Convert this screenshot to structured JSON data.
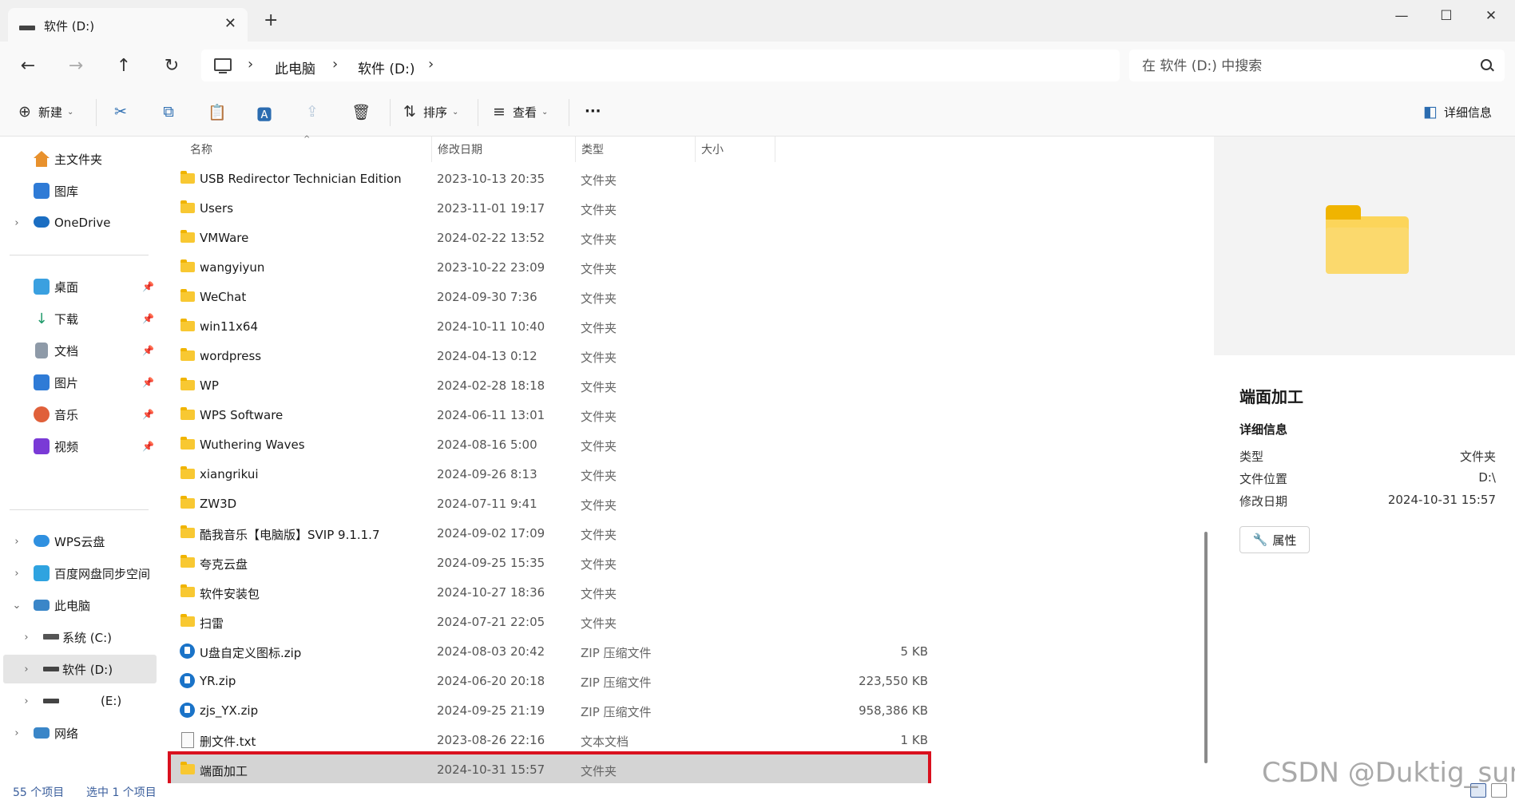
{
  "window": {
    "tab_title": "软件 (D:)",
    "tab_close": "✕",
    "new_tab": "+",
    "controls": {
      "minimize": "—",
      "maximize": "☐",
      "close": "✕"
    }
  },
  "nav": {
    "back": "←",
    "forward": "→",
    "up": "↑",
    "refresh": "↻",
    "breadcrumb": [
      "此电脑",
      "软件 (D:)"
    ],
    "separator": "›"
  },
  "search": {
    "placeholder": "在 软件 (D:) 中搜索"
  },
  "toolbar": {
    "new": "新建",
    "sort": "排序",
    "view": "查看",
    "more": "···",
    "details": "详细信息",
    "icons": {
      "new": "⊕",
      "cut": "✂",
      "copy": "⧉",
      "paste": "📋",
      "rename": "🅰",
      "share": "⇪",
      "delete": "🗑",
      "sort": "⇅",
      "view": "≡",
      "details": "◧"
    }
  },
  "sidebar": {
    "quick": [
      {
        "label": "主文件夹",
        "icon": "home-icon",
        "color": "#e8912d"
      },
      {
        "label": "图库",
        "icon": "gallery-icon",
        "color": "#2f7bd6"
      },
      {
        "label": "OneDrive",
        "icon": "onedrive-icon",
        "color": "#1b6ec2"
      }
    ],
    "pinned": [
      {
        "label": "桌面",
        "icon": "desktop-icon",
        "color": "#3aa0e0"
      },
      {
        "label": "下载",
        "icon": "download-icon",
        "color": "#1f9a6a"
      },
      {
        "label": "文档",
        "icon": "documents-icon",
        "color": "#8e9aa8"
      },
      {
        "label": "图片",
        "icon": "pictures-icon",
        "color": "#2f7bd6"
      },
      {
        "label": "音乐",
        "icon": "music-icon",
        "color": "#e0603a"
      },
      {
        "label": "视频",
        "icon": "videos-icon",
        "color": "#7a3ad6"
      }
    ],
    "places": [
      {
        "label": "WPS云盘",
        "icon": "wps-cloud-icon",
        "color": "#2f90e0"
      },
      {
        "label": "百度网盘同步空间",
        "icon": "baidu-netdisk-icon",
        "color": "#2fa3e0"
      },
      {
        "label": "此电脑",
        "icon": "this-pc-icon",
        "color": "#3a86c8"
      },
      {
        "label": "系统 (C:)",
        "icon": "drive-c-icon",
        "color": "#555555"
      },
      {
        "label": "软件 (D:)",
        "icon": "drive-d-icon",
        "color": "#444444"
      },
      {
        "label": "(E:)",
        "icon": "drive-e-icon",
        "color": "#444444"
      },
      {
        "label": "网络",
        "icon": "network-icon",
        "color": "#3a86c8"
      }
    ]
  },
  "columns": {
    "name": "名称",
    "date": "修改日期",
    "type": "类型",
    "size": "大小"
  },
  "files": [
    {
      "name": "USB Redirector Technician Edition",
      "date": "2023-10-13 20:35",
      "type": "文件夹",
      "size": "",
      "kind": "folder"
    },
    {
      "name": "Users",
      "date": "2023-11-01 19:17",
      "type": "文件夹",
      "size": "",
      "kind": "folder"
    },
    {
      "name": "VMWare",
      "date": "2024-02-22 13:52",
      "type": "文件夹",
      "size": "",
      "kind": "folder"
    },
    {
      "name": "wangyiyun",
      "date": "2023-10-22 23:09",
      "type": "文件夹",
      "size": "",
      "kind": "folder"
    },
    {
      "name": "WeChat",
      "date": "2024-09-30 7:36",
      "type": "文件夹",
      "size": "",
      "kind": "folder"
    },
    {
      "name": "win11x64",
      "date": "2024-10-11 10:40",
      "type": "文件夹",
      "size": "",
      "kind": "folder"
    },
    {
      "name": "wordpress",
      "date": "2024-04-13 0:12",
      "type": "文件夹",
      "size": "",
      "kind": "folder"
    },
    {
      "name": "WP",
      "date": "2024-02-28 18:18",
      "type": "文件夹",
      "size": "",
      "kind": "folder"
    },
    {
      "name": "WPS Software",
      "date": "2024-06-11 13:01",
      "type": "文件夹",
      "size": "",
      "kind": "folder"
    },
    {
      "name": "Wuthering Waves",
      "date": "2024-08-16 5:00",
      "type": "文件夹",
      "size": "",
      "kind": "folder"
    },
    {
      "name": "xiangrikui",
      "date": "2024-09-26 8:13",
      "type": "文件夹",
      "size": "",
      "kind": "folder"
    },
    {
      "name": "ZW3D",
      "date": "2024-07-11 9:41",
      "type": "文件夹",
      "size": "",
      "kind": "folder"
    },
    {
      "name": "酷我音乐【电脑版】SVIP 9.1.1.7",
      "date": "2024-09-02 17:09",
      "type": "文件夹",
      "size": "",
      "kind": "folder"
    },
    {
      "name": "夸克云盘",
      "date": "2024-09-25 15:35",
      "type": "文件夹",
      "size": "",
      "kind": "folder"
    },
    {
      "name": "软件安装包",
      "date": "2024-10-27 18:36",
      "type": "文件夹",
      "size": "",
      "kind": "folder"
    },
    {
      "name": "扫雷",
      "date": "2024-07-21 22:05",
      "type": "文件夹",
      "size": "",
      "kind": "folder"
    },
    {
      "name": "U盘自定义图标.zip",
      "date": "2024-08-03 20:42",
      "type": "ZIP 压缩文件",
      "size": "5 KB",
      "kind": "zip"
    },
    {
      "name": "YR.zip",
      "date": "2024-06-20 20:18",
      "type": "ZIP 压缩文件",
      "size": "223,550 KB",
      "kind": "zip"
    },
    {
      "name": "zjs_YX.zip",
      "date": "2024-09-25 21:19",
      "type": "ZIP 压缩文件",
      "size": "958,386 KB",
      "kind": "zip"
    },
    {
      "name": "删文件.txt",
      "date": "2023-08-26 22:16",
      "type": "文本文档",
      "size": "1 KB",
      "kind": "txt"
    },
    {
      "name": "端面加工",
      "date": "2024-10-31 15:57",
      "type": "文件夹",
      "size": "",
      "kind": "folder",
      "selected": true
    }
  ],
  "details": {
    "title": "端面加工",
    "section": "详细信息",
    "rows": [
      {
        "key": "类型",
        "value": "文件夹"
      },
      {
        "key": "文件位置",
        "value": "D:\\"
      },
      {
        "key": "修改日期",
        "value": "2024-10-31 15:57"
      }
    ],
    "properties_button": "属性"
  },
  "status": {
    "count": "55 个项目",
    "selected": "选中 1 个项目"
  },
  "watermark": "CSDN @Duktig_sun"
}
